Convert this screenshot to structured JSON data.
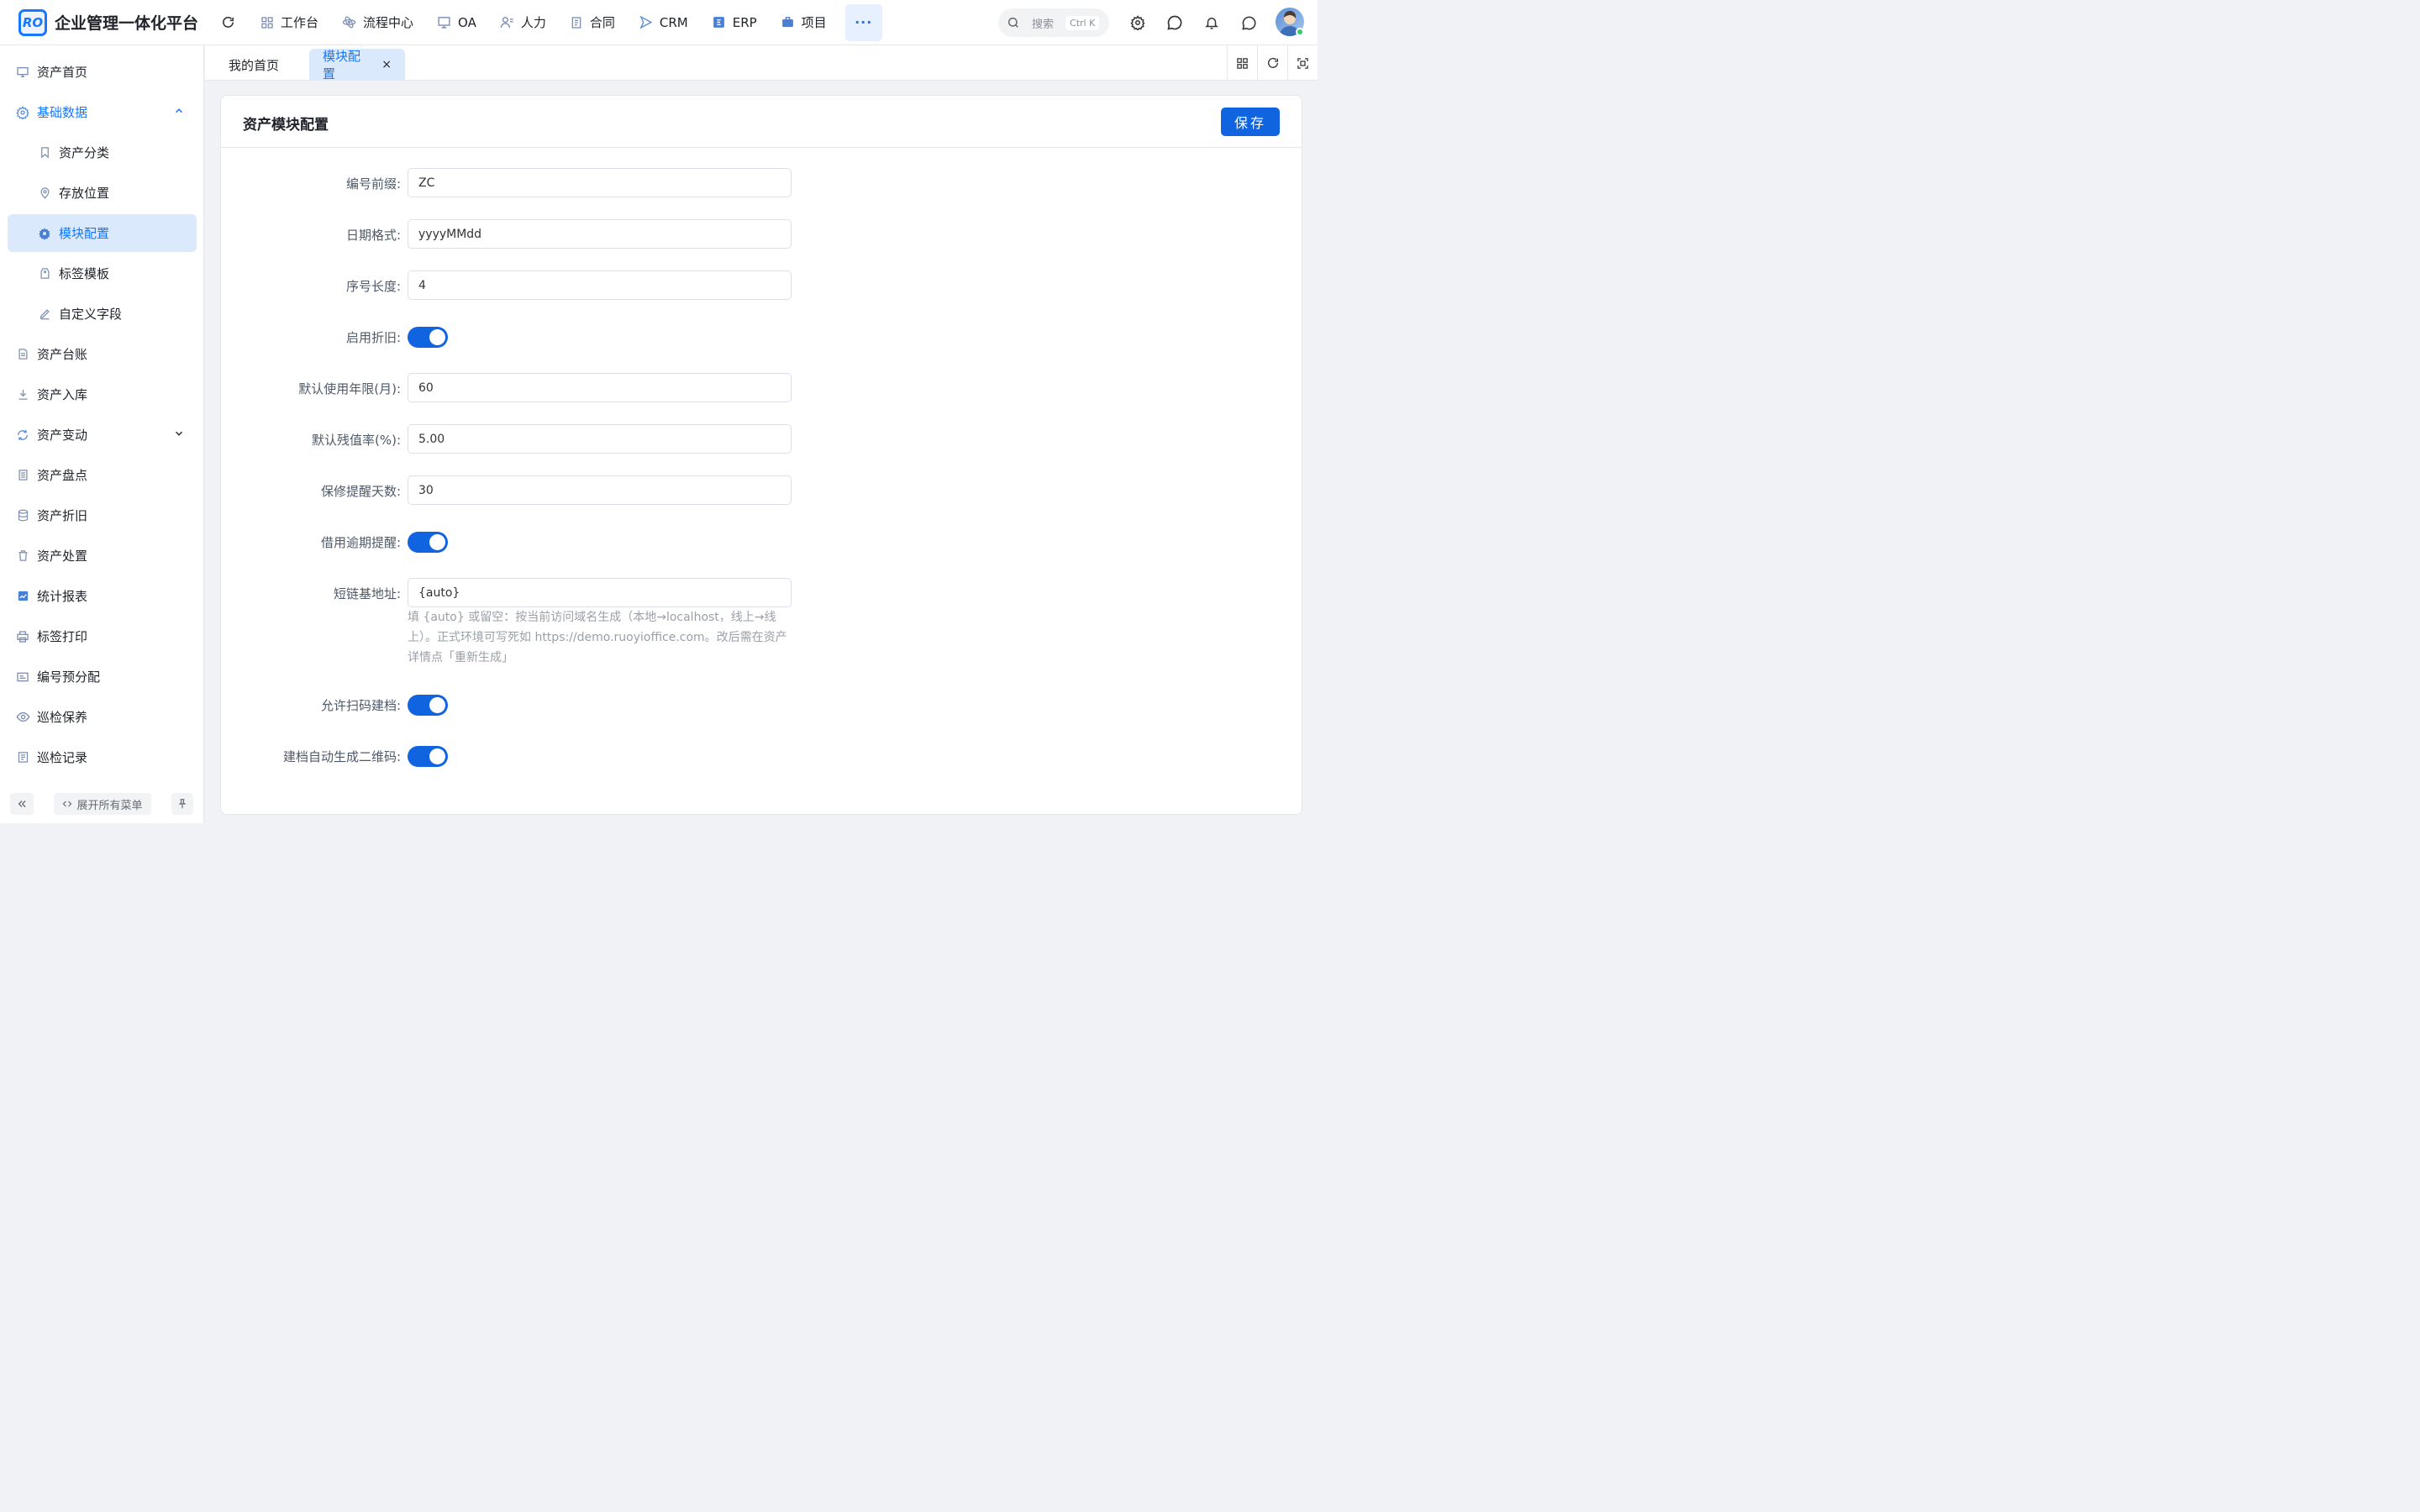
{
  "app": {
    "logo_mark": "RO",
    "title": "企业管理一体化平台"
  },
  "nav": {
    "items": [
      "工作台",
      "流程中心",
      "OA",
      "人力",
      "合同",
      "CRM",
      "ERP",
      "项目"
    ],
    "more_label": "···"
  },
  "search": {
    "placeholder": "搜索",
    "shortcut": "Ctrl K"
  },
  "sidebar": {
    "items": [
      {
        "label": "资产首页",
        "icon": "monitor-icon"
      },
      {
        "label": "基础数据",
        "icon": "gear-icon"
      },
      {
        "label": "资产分类",
        "icon": "bookmark-icon"
      },
      {
        "label": "存放位置",
        "icon": "location-pin-icon"
      },
      {
        "label": "模块配置",
        "icon": "gear-icon"
      },
      {
        "label": "标签模板",
        "icon": "tag-icon"
      },
      {
        "label": "自定义字段",
        "icon": "edit-icon"
      },
      {
        "label": "资产台账",
        "icon": "document-icon"
      },
      {
        "label": "资产入库",
        "icon": "download-icon"
      },
      {
        "label": "资产变动",
        "icon": "sync-icon"
      },
      {
        "label": "资产盘点",
        "icon": "list-document-icon"
      },
      {
        "label": "资产折旧",
        "icon": "database-icon"
      },
      {
        "label": "资产处置",
        "icon": "trash-icon"
      },
      {
        "label": "统计报表",
        "icon": "chart-icon"
      },
      {
        "label": "标签打印",
        "icon": "printer-icon"
      },
      {
        "label": "编号预分配",
        "icon": "id-card-icon"
      },
      {
        "label": "巡检保养",
        "icon": "eye-icon"
      },
      {
        "label": "巡检记录",
        "icon": "notes-icon"
      }
    ],
    "expand_all_label": "展开所有菜单"
  },
  "tabs": [
    {
      "label": "我的首页"
    },
    {
      "label": "模块配置",
      "close": "×"
    }
  ],
  "page": {
    "title": "资产模块配置",
    "save_label": "保存"
  },
  "form": {
    "code_prefix": {
      "label": "编号前缀:",
      "value": "ZC"
    },
    "date_format": {
      "label": "日期格式:",
      "value": "yyyyMMdd"
    },
    "seq_length": {
      "label": "序号长度:",
      "value": "4"
    },
    "enable_depreciation": {
      "label": "启用折旧:",
      "on": true
    },
    "default_years": {
      "label": "默认使用年限(月):",
      "value": "60"
    },
    "residual_rate": {
      "label": "默认残值率(%):",
      "value": "5.00"
    },
    "warranty_days": {
      "label": "保修提醒天数:",
      "value": "30"
    },
    "borrow_overdue": {
      "label": "借用逾期提醒:",
      "on": true
    },
    "short_link": {
      "label": "短链基地址:",
      "value": "{auto}",
      "hint": "填 {auto} 或留空：按当前访问域名生成（本地→localhost，线上→线上）。正式环境可写死如 https://demo.ruoyioffice.com。改后需在资产详情点「重新生成」"
    },
    "allow_scan_archive": {
      "label": "允许扫码建档:",
      "on": true
    },
    "auto_qrcode": {
      "label": "建档自动生成二维码:",
      "on": true
    }
  },
  "colors": {
    "primary": "#1064e0",
    "active_bg": "#dbe9fd"
  }
}
